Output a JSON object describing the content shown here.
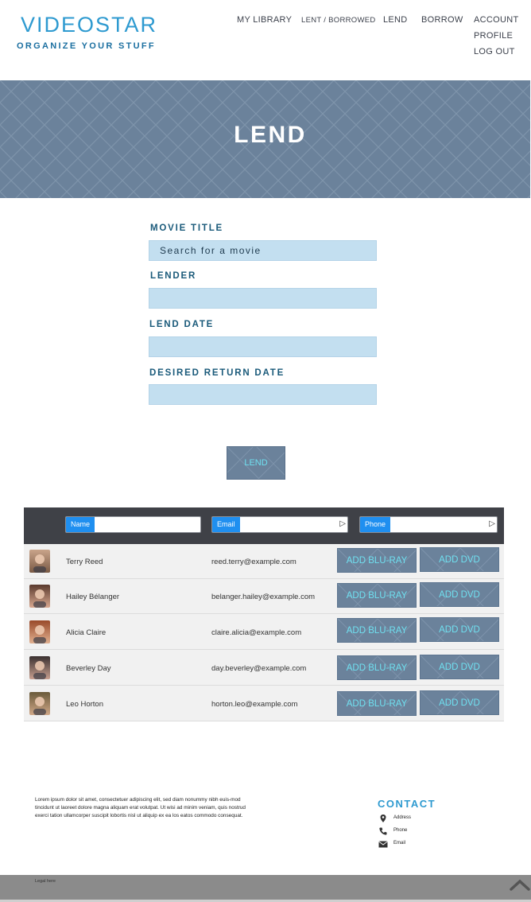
{
  "header": {
    "logo_title": "VIDEOSTAR",
    "logo_subtitle": "ORGANIZE YOUR STUFF",
    "nav": {
      "my_library": "MY LIBRARY",
      "lent_borrowed": "LENT / BORROWED",
      "lend": "LEND",
      "borrow": "BORROW",
      "account": "ACCOUNT",
      "profile": "PROFILE",
      "log_out": "LOG OUT"
    }
  },
  "hero": {
    "title": "LEND"
  },
  "form": {
    "movie_title_label": "MOVIE TITLE",
    "movie_title_placeholder": "Search for a movie",
    "lender_label": "LENDER",
    "lend_date_label": "LEND DATE",
    "desired_return_label": "DESIRED RETURN DATE",
    "submit_label": "LEND"
  },
  "table": {
    "filters": {
      "name": "Name",
      "email": "Email",
      "phone": "Phone"
    },
    "rows": [
      {
        "name": "Terry Reed",
        "email": "reed.terry@example.com",
        "blu_ray": "ADD BLU-RAY",
        "dvd": "ADD DVD"
      },
      {
        "name": "Hailey Bélanger",
        "email": "belanger.hailey@example.com",
        "blu_ray": "ADD BLU-RAY",
        "dvd": "ADD DVD"
      },
      {
        "name": "Alicia Claire",
        "email": "claire.alicia@example.com",
        "blu_ray": "ADD BLU-RAY",
        "dvd": "ADD DVD"
      },
      {
        "name": "Beverley Day",
        "email": "day.beverley@example.com",
        "blu_ray": "ADD BLU-RAY",
        "dvd": "ADD DVD"
      },
      {
        "name": "Leo Horton",
        "email": "horton.leo@example.com",
        "blu_ray": "ADD BLU-RAY",
        "dvd": "ADD DVD"
      }
    ]
  },
  "footer": {
    "lorem": "Lorem ipsum dolor sit amet, consectetuer adipiscing elit, sed diam nonummy nibh euis-mod tincidunt ut laoreet dolore magna aliquam erat volutpat. Ut wisi ad minim veniam, quis nostrud exerci tation ullamcorper suscipit lobortis nisl ut aliquip ex ea los eatos commodo consequat.",
    "contact_title": "CONTACT",
    "address": "Address",
    "phone": "Phone",
    "email": "Email",
    "legal": "Legal here"
  },
  "colors": {
    "accent_blue": "#2e9ad0",
    "button_slate": "#6b829b",
    "button_text_cyan": "#6fe0f0",
    "input_fill": "#c3dff0"
  }
}
